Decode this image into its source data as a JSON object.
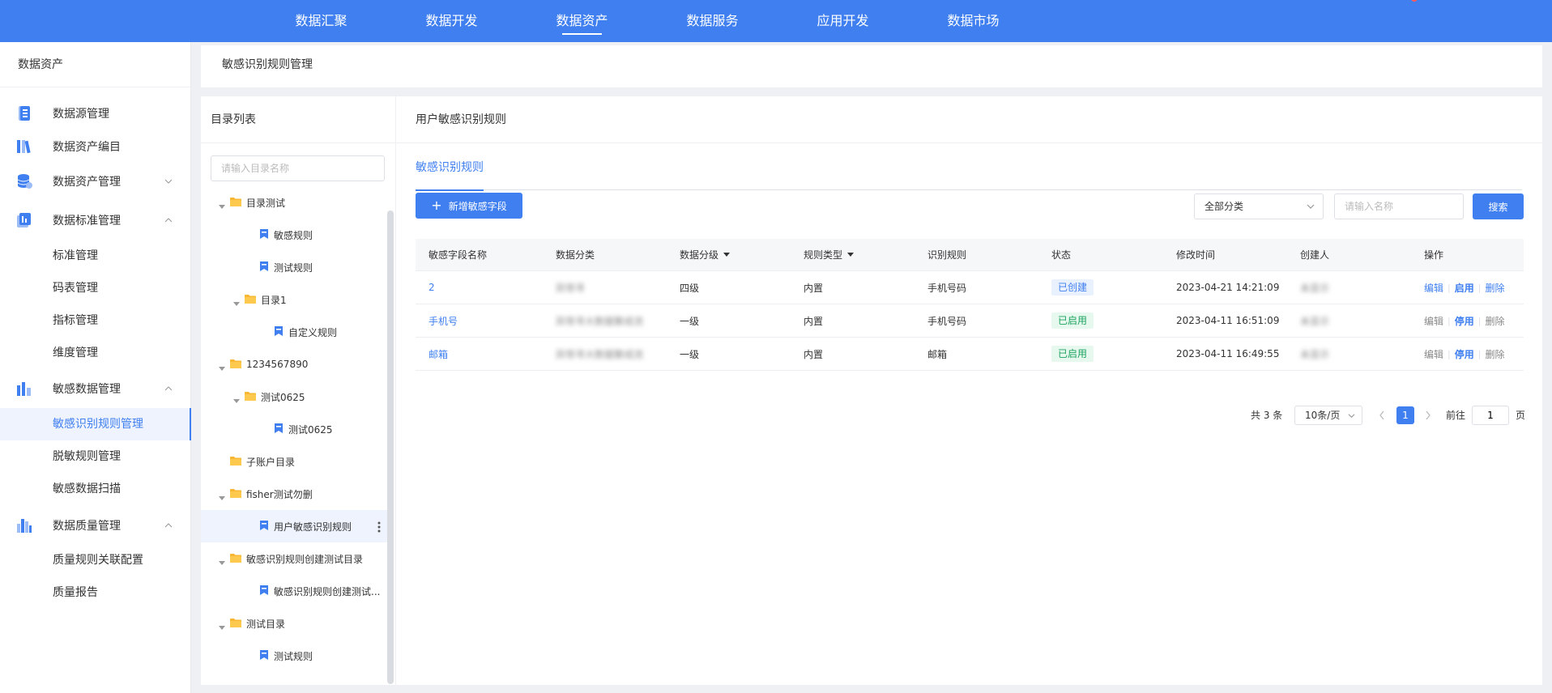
{
  "topnav": {
    "items": [
      "数据汇聚",
      "数据开发",
      "数据资产",
      "数据服务",
      "应用开发",
      "数据市场"
    ],
    "active_index": 2
  },
  "sidebar": {
    "title": "数据资产",
    "groups": [
      {
        "label": "数据源管理",
        "icon": "datasource-icon"
      },
      {
        "label": "数据资产编目",
        "icon": "catalog-icon"
      },
      {
        "label": "数据资产管理",
        "icon": "database-icon",
        "expanded": false
      },
      {
        "label": "数据标准管理",
        "icon": "standard-icon",
        "expanded": true,
        "children": [
          "标准管理",
          "码表管理",
          "指标管理",
          "维度管理"
        ]
      },
      {
        "label": "敏感数据管理",
        "icon": "sensitive-icon",
        "expanded": true,
        "children": [
          "敏感识别规则管理",
          "脱敏规则管理",
          "敏感数据扫描"
        ]
      },
      {
        "label": "数据质量管理",
        "icon": "quality-icon",
        "expanded": true,
        "children": [
          "质量规则关联配置",
          "质量报告"
        ]
      }
    ],
    "active_item": "敏感识别规则管理"
  },
  "breadcrumb": "敏感识别规则管理",
  "tree": {
    "title": "目录列表",
    "search_placeholder": "请输入目录名称",
    "nodes": [
      {
        "label": "目录测试",
        "type": "folder",
        "level": 0,
        "expanded": true
      },
      {
        "label": "敏感规则",
        "type": "rule",
        "level": 1
      },
      {
        "label": "测试规则",
        "type": "rule",
        "level": 1
      },
      {
        "label": "目录1",
        "type": "folder",
        "level": 1,
        "expanded": true
      },
      {
        "label": "自定义规则",
        "type": "rule",
        "level": 2
      },
      {
        "label": "1234567890",
        "type": "folder",
        "level": 0,
        "expanded": true
      },
      {
        "label": "测试0625",
        "type": "folder",
        "level": 1,
        "expanded": true
      },
      {
        "label": "测试0625",
        "type": "rule",
        "level": 2
      },
      {
        "label": "子账户目录",
        "type": "folder",
        "level": 0,
        "expanded": false,
        "leaf": true
      },
      {
        "label": "fisher测试勿删",
        "type": "folder",
        "level": 0,
        "expanded": true
      },
      {
        "label": "用户敏感识别规则",
        "type": "rule",
        "level": 1,
        "active": true
      },
      {
        "label": "敏感识别规则创建测试目录",
        "type": "folder",
        "level": 0,
        "expanded": true
      },
      {
        "label": "敏感识别规则创建测试...",
        "type": "rule",
        "level": 1
      },
      {
        "label": "测试目录",
        "type": "folder",
        "level": 0,
        "expanded": true
      },
      {
        "label": "测试规则",
        "type": "rule",
        "level": 1
      }
    ]
  },
  "main": {
    "title": "用户敏感识别规则",
    "tab": "敏感识别规则",
    "add_button": "新增敏感字段",
    "category_select": "全部分类",
    "name_placeholder": "请输入名称",
    "search_button": "搜索",
    "columns": [
      "敏感字段名称",
      "数据分类",
      "数据分级",
      "规则类型",
      "识别规则",
      "状态",
      "修改时间",
      "创建人",
      "操作"
    ],
    "rows": [
      {
        "name": "2",
        "category": "异常寻",
        "level": "四级",
        "rule_type": "内置",
        "rule": "手机号码",
        "status": "已创建",
        "status_kind": "created",
        "modified": "2023-04-21 14:21:09",
        "creator": "未显示",
        "ops": [
          "编辑",
          "启用",
          "删除"
        ]
      },
      {
        "name": "手机号",
        "category": "异常寻大数据聚成流",
        "level": "一级",
        "rule_type": "内置",
        "rule": "手机号码",
        "status": "已启用",
        "status_kind": "enabled",
        "modified": "2023-04-11 16:51:09",
        "creator": "未显示",
        "ops": [
          "编辑",
          "停用",
          "删除"
        ]
      },
      {
        "name": "邮箱",
        "category": "异常寻大数据聚成流",
        "level": "一级",
        "rule_type": "内置",
        "rule": "邮箱",
        "status": "已启用",
        "status_kind": "enabled",
        "modified": "2023-04-11 16:49:55",
        "creator": "未显示",
        "ops": [
          "编辑",
          "停用",
          "删除"
        ]
      }
    ],
    "pagination": {
      "total": "共 3 条",
      "page_size": "10条/页",
      "current": "1",
      "goto_label": "前往",
      "goto_value": "1",
      "page_label": "页"
    }
  },
  "colors": {
    "primary": "#3f7ff0",
    "enabled": "#1ba360",
    "folder": "#f7b733"
  }
}
